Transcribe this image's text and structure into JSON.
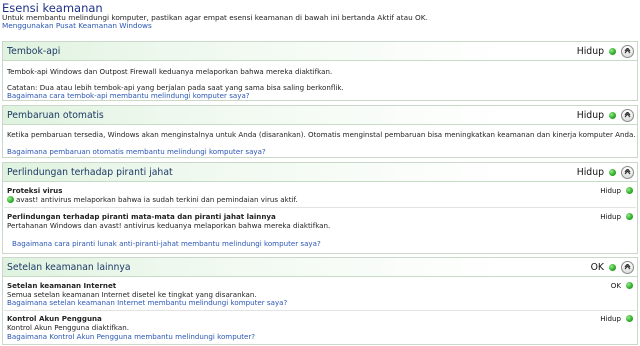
{
  "header": {
    "title": "Esensi keamanan",
    "intro": "Untuk membantu melindungi komputer, pastikan agar empat esensi keamanan di bawah ini bertanda Aktif atau OK.",
    "using_link": "Menggunakan Pusat Keamanan Windows"
  },
  "sections": {
    "firewall": {
      "name": "Tembok-api",
      "state": "Hidup",
      "line1": "Tembok-api Windows dan Outpost Firewall keduanya melaporkan bahwa mereka diaktifkan.",
      "line2": "Catatan: Dua atau lebih tembok-api yang berjalan pada saat yang sama bisa saling berkonflik.",
      "link": "Bagaimana cara tembok-api membantu melindungi komputer saya?"
    },
    "update": {
      "name": "Pembaruan otomatis",
      "state": "Hidup",
      "line1": "Ketika pembaruan tersedia, Windows akan menginstalnya untuk Anda (disarankan). Otomatis menginstal pembaruan bisa meningkatkan keamanan dan kinerja komputer Anda.",
      "link": "Bagaimana pembaruan otomatis membantu melindungi komputer saya?"
    },
    "malware": {
      "name": "Perlindungan terhadap piranti jahat",
      "state": "Hidup",
      "virus_title": "Proteksi virus",
      "virus_state": "Hidup",
      "virus_text": "avast! antivirus melaporkan bahwa ia sudah terkini dan pemindaian virus aktif.",
      "spy_title": "Perlindungan terhadap piranti mata-mata dan piranti jahat lainnya",
      "spy_state": "Hidup",
      "spy_text": "Pertahanan Windows dan avast! antivirus keduanya melaporkan bahwa mereka diaktifkan.",
      "link": "Bagaimana cara piranti lunak anti-piranti-jahat membantu melindungi komputer saya?"
    },
    "other": {
      "name": "Setelan keamanan lainnya",
      "state": "OK",
      "internet_title": "Setelan keamanan Internet",
      "internet_state": "OK",
      "internet_text": "Semua setelan keamanan Internet disetel ke tingkat yang disarankan.",
      "internet_link": "Bagaimana setelan keamanan Internet membantu melindungi komputer saya?",
      "uac_title": "Kontrol Akun Pengguna",
      "uac_state": "Hidup",
      "uac_text": "Kontrol Akun Pengguna diaktifkan.",
      "uac_link": "Bagaimana Kontrol Akun Pengguna membantu melindungi komputer?"
    }
  },
  "icons": {
    "status": "green-status-dot-icon",
    "collapse": "chevron-up-icon",
    "avast": "avast-shield-icon"
  },
  "colors": {
    "link": "#2a56b5",
    "title": "#1e3287",
    "ok_green": "#2fb12a",
    "header_tint": "#dff2df"
  }
}
